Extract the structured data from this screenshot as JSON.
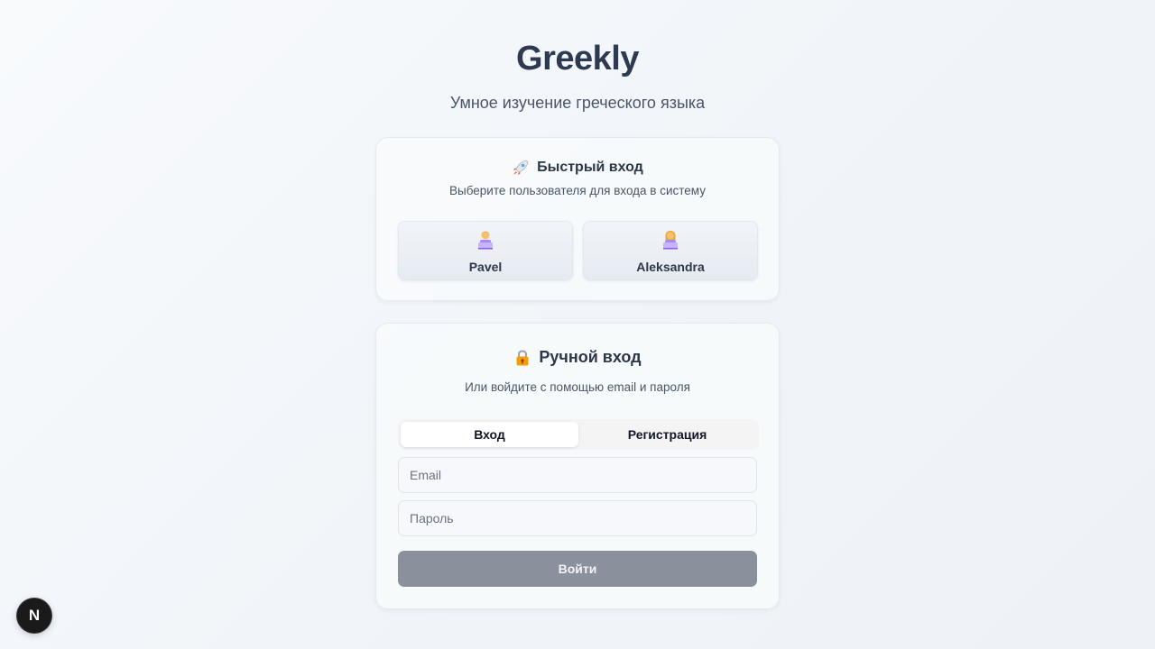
{
  "app": {
    "title": "Greekly",
    "subtitle": "Умное изучение греческого языка"
  },
  "quick_login": {
    "icon": "rocket-icon",
    "title": "Быстрый вход",
    "description": "Выберите пользователя для входа в систему",
    "users": [
      {
        "name": "Pavel",
        "avatar": "man-technologist-icon"
      },
      {
        "name": "Aleksandra",
        "avatar": "woman-technologist-icon"
      }
    ]
  },
  "manual_login": {
    "icon": "lock-icon",
    "title": "Ручной вход",
    "description": "Или войдите с помощью email и пароля",
    "tabs": [
      {
        "label": "Вход",
        "active": true
      },
      {
        "label": "Регистрация",
        "active": false
      }
    ],
    "email": {
      "value": "",
      "placeholder": "Email"
    },
    "password": {
      "value": "",
      "placeholder": "Пароль"
    },
    "submit_label": "Войти"
  },
  "dev_badge": {
    "label": "N"
  },
  "colors": {
    "title": "#2d3a50",
    "submit_disabled": "#8a919d",
    "dev_badge_bg": "#1a1a1a"
  }
}
